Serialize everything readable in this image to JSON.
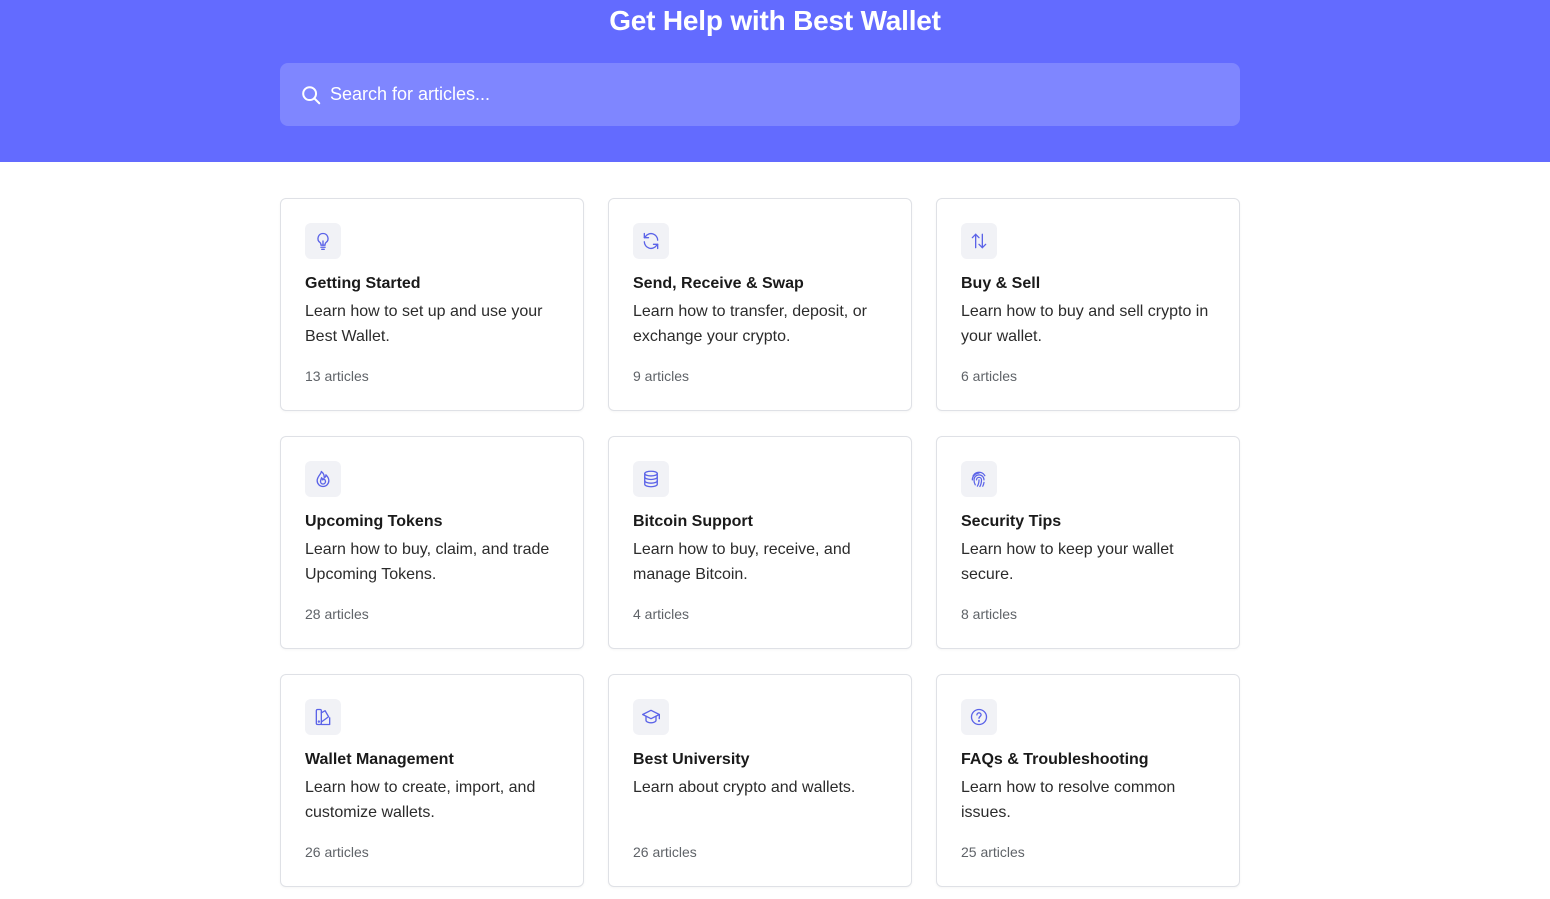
{
  "header": {
    "title": "Get Help with Best Wallet"
  },
  "search": {
    "placeholder": "Search for articles...",
    "icon": "search-icon"
  },
  "colors": {
    "hero_background": "#636bff",
    "search_background": "#7f86ff",
    "icon_accent": "#5b63e8",
    "card_border": "#dfe1e6"
  },
  "categories": [
    {
      "icon": "lightbulb-icon",
      "title": "Getting Started",
      "description": "Learn how to set up and use your Best Wallet.",
      "count": "13 articles"
    },
    {
      "icon": "refresh-icon",
      "title": "Send, Receive & Swap",
      "description": "Learn how to transfer, deposit, or exchange your crypto.",
      "count": "9 articles"
    },
    {
      "icon": "arrows-up-down-icon",
      "title": "Buy & Sell",
      "description": "Learn how to buy and sell crypto in your wallet.",
      "count": "6 articles"
    },
    {
      "icon": "flame-icon",
      "title": "Upcoming Tokens",
      "description": "Learn how to buy, claim, and trade Upcoming Tokens.",
      "count": "28 articles"
    },
    {
      "icon": "database-icon",
      "title": "Bitcoin Support",
      "description": "Learn how to buy, receive, and manage Bitcoin.",
      "count": "4 articles"
    },
    {
      "icon": "fingerprint-icon",
      "title": "Security Tips",
      "description": "Learn how to keep your wallet secure.",
      "count": "8 articles"
    },
    {
      "icon": "wallet-swatch-icon",
      "title": "Wallet Management",
      "description": "Learn how to create, import, and customize wallets.",
      "count": "26 articles"
    },
    {
      "icon": "graduation-cap-icon",
      "title": "Best University",
      "description": "Learn about crypto and wallets.",
      "count": "26 articles"
    },
    {
      "icon": "question-circle-icon",
      "title": "FAQs & Troubleshooting",
      "description": "Learn how to resolve common issues.",
      "count": "25 articles"
    }
  ]
}
